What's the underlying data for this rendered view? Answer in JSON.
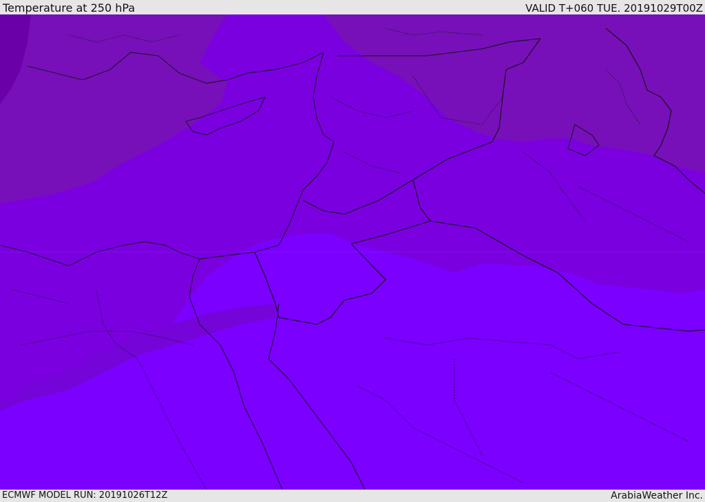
{
  "header": {
    "title": "Temperature at 250 hPa",
    "valid": "VALID T+060 TUE. 20191029T00Z"
  },
  "footer": {
    "model_run": "ECMWF MODEL RUN: 20191026T12Z",
    "credit": "ArabiaWeather Inc."
  },
  "map": {
    "colors": {
      "band_cold": "#6a00a8",
      "band_cool": "#7710b8",
      "band_mid": "#7a00e0",
      "band_warm": "#7b00ff",
      "border": "#111111"
    }
  }
}
